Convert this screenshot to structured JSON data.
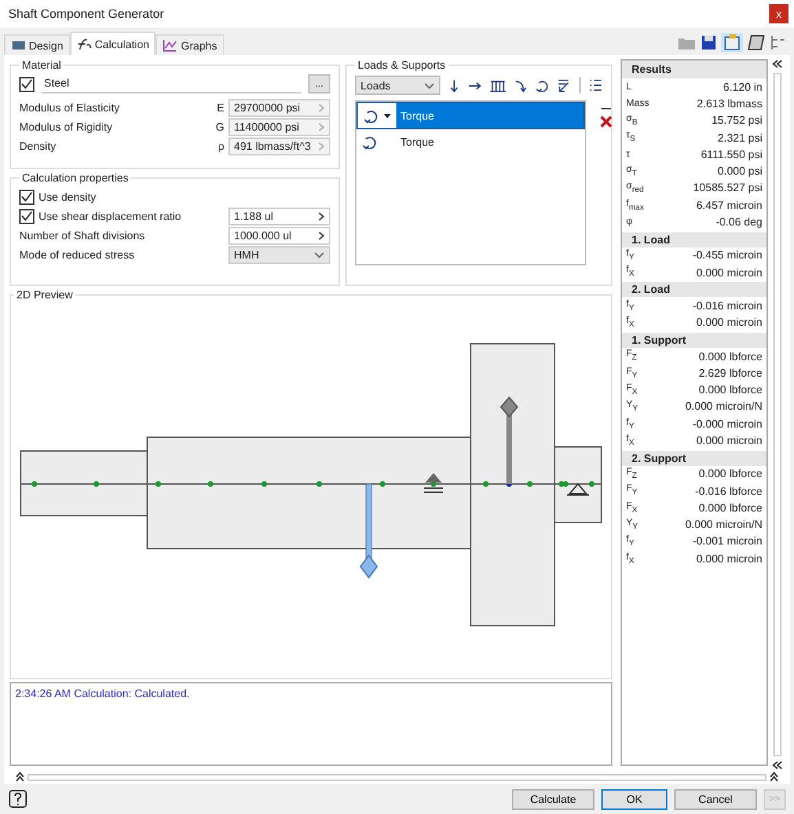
{
  "window": {
    "title": "Shaft Component Generator",
    "close": "x"
  },
  "tabs": [
    {
      "label": "Design",
      "selected": false
    },
    {
      "label": "Calculation",
      "selected": true
    },
    {
      "label": "Graphs",
      "selected": false
    }
  ],
  "material": {
    "title": "Material",
    "checked": true,
    "name": "Steel",
    "browse": "...",
    "properties": [
      {
        "label": "Modulus of Elasticity",
        "symbol": "E",
        "value": "29700000 psi"
      },
      {
        "label": "Modulus of Rigidity",
        "symbol": "G",
        "value": "11400000 psi"
      },
      {
        "label": "Density",
        "symbol": "ρ",
        "value": "491 lbmass/ft^3"
      }
    ]
  },
  "calculation_properties": {
    "title": "Calculation properties",
    "items": [
      {
        "kind": "checkbox",
        "label": "Use density",
        "checked": true
      },
      {
        "kind": "checkfield",
        "label": "Use shear displacement ratio",
        "checked": true,
        "value": "1.188 ul"
      },
      {
        "kind": "field",
        "label": "Number of Shaft divisions",
        "value": "1000.000 ul"
      },
      {
        "kind": "select",
        "label": "Mode of reduced stress",
        "value": "HMH"
      }
    ]
  },
  "loads_supports": {
    "title": "Loads & Supports",
    "dropdown": "Loads",
    "items": [
      {
        "label": "Torque",
        "selected": true
      },
      {
        "label": "Torque",
        "selected": false
      }
    ]
  },
  "preview": {
    "title": "2D Preview"
  },
  "log": [
    "2:34:26 AM Calculation: Calculated."
  ],
  "results": {
    "title": "Results",
    "sections": [
      {
        "rows": [
          {
            "name": "L",
            "value": "6.120 in"
          },
          {
            "name": "Mass",
            "value": "2.613 lbmass"
          },
          {
            "name": "σ$_{B}$",
            "value": "15.752 psi"
          },
          {
            "name": "τ$_{S}$",
            "value": "2.321 psi"
          },
          {
            "name": "τ",
            "value": "6111.550 psi"
          },
          {
            "name": "σ$_{T}$",
            "value": "0.000 psi"
          },
          {
            "name": "σ$_{red}$",
            "value": "10585.527 psi"
          },
          {
            "name": "f$_{max}$",
            "value": "6.457 microin"
          },
          {
            "name": "φ",
            "value": "-0.06 deg"
          }
        ]
      },
      {
        "title": "1. Load",
        "rows": [
          {
            "name": "f$_{Y}$",
            "value": "-0.455 microin"
          },
          {
            "name": "f$_{X}$",
            "value": "0.000 microin"
          }
        ]
      },
      {
        "title": "2. Load",
        "rows": [
          {
            "name": "f$_{Y}$",
            "value": "-0.016 microin"
          },
          {
            "name": "f$_{X}$",
            "value": "0.000 microin"
          }
        ]
      },
      {
        "title": "1. Support",
        "rows": [
          {
            "name": "F$_{Z}$",
            "value": "0.000 lbforce"
          },
          {
            "name": "F$_{Y}$",
            "value": "2.629 lbforce"
          },
          {
            "name": "F$_{X}$",
            "value": "0.000 lbforce"
          },
          {
            "name": "Y$_{Y}$",
            "value": "0.000 microin/N"
          },
          {
            "name": "f$_{Y}$",
            "value": "-0.000 microin"
          },
          {
            "name": "f$_{X}$",
            "value": "0.000 microin"
          }
        ]
      },
      {
        "title": "2. Support",
        "rows": [
          {
            "name": "F$_{Z}$",
            "value": "0.000 lbforce"
          },
          {
            "name": "F$_{Y}$",
            "value": "-0.016 lbforce"
          },
          {
            "name": "F$_{X}$",
            "value": "0.000 lbforce"
          },
          {
            "name": "Y$_{Y}$",
            "value": "0.000 microin/N"
          },
          {
            "name": "f$_{Y}$",
            "value": "-0.001 microin"
          },
          {
            "name": "f$_{X}$",
            "value": "0.000 microin"
          }
        ]
      }
    ]
  },
  "buttons": [
    {
      "label": "Calculate",
      "default": false
    },
    {
      "label": "OK",
      "default": true
    },
    {
      "label": "Cancel",
      "default": false
    }
  ],
  "more": ">>"
}
